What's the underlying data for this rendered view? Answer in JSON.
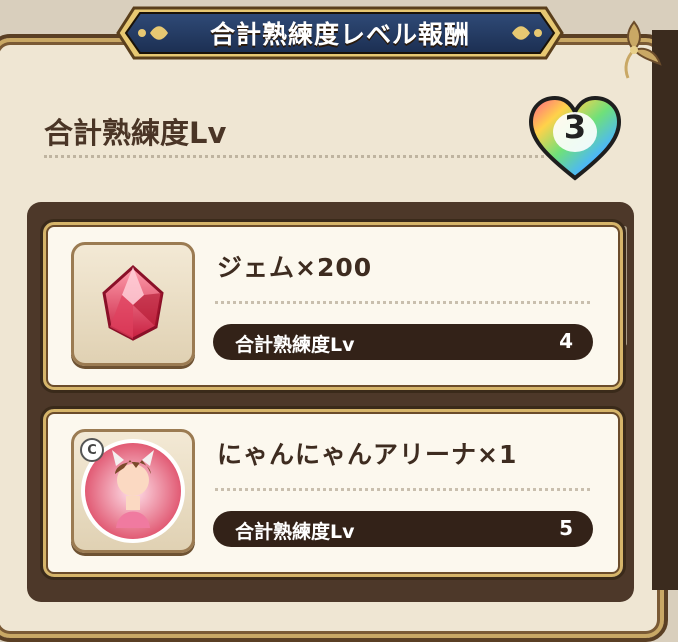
{
  "header": {
    "title": "合計熟練度レベル報酬"
  },
  "summary": {
    "label": "合計熟練度Lv",
    "level": "3"
  },
  "rewards": [
    {
      "name": "ジェム×200",
      "icon": "gem-icon",
      "requirement_label": "合計熟練度Lv",
      "requirement_value": "4"
    },
    {
      "name": "にゃんにゃんアリーナ×1",
      "icon": "character-portrait-icon",
      "badge": "C",
      "requirement_label": "合計熟練度Lv",
      "requirement_value": "5"
    }
  ],
  "colors": {
    "frame": "#5a3f24",
    "gold": "#d6b56a",
    "panel": "#4d3829",
    "card": "#fcf8ee"
  }
}
